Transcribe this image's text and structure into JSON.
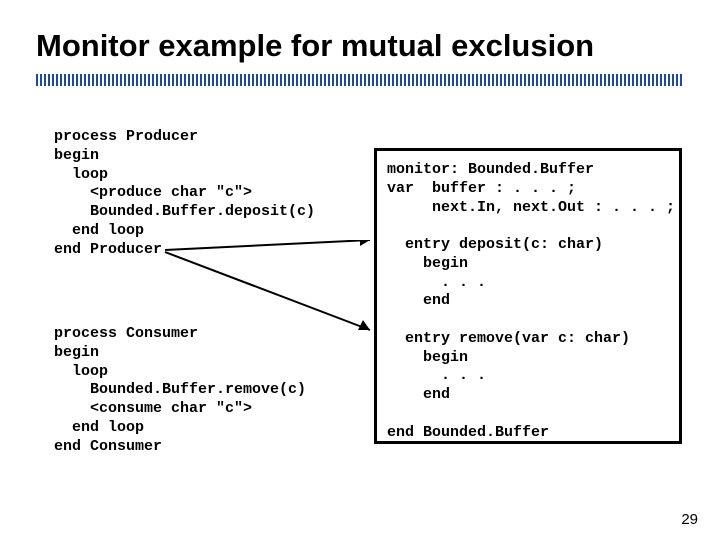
{
  "title": "Monitor example for mutual exclusion",
  "producer_code": "process Producer\nbegin\n  loop\n    <produce char \"c\">\n    Bounded.Buffer.deposit(c)\n  end loop\nend Producer",
  "consumer_code": "process Consumer\nbegin\n  loop\n    Bounded.Buffer.remove(c)\n    <consume char \"c\">\n  end loop\nend Consumer",
  "monitor_code": "monitor: Bounded.Buffer\nvar  buffer : . . . ;\n     next.In, next.Out : . . . ;\n\n  entry deposit(c: char)\n    begin\n      . . .\n    end\n\n  entry remove(var c: char)\n    begin\n      . . .\n    end\n\nend Bounded.Buffer",
  "page_number": "29"
}
